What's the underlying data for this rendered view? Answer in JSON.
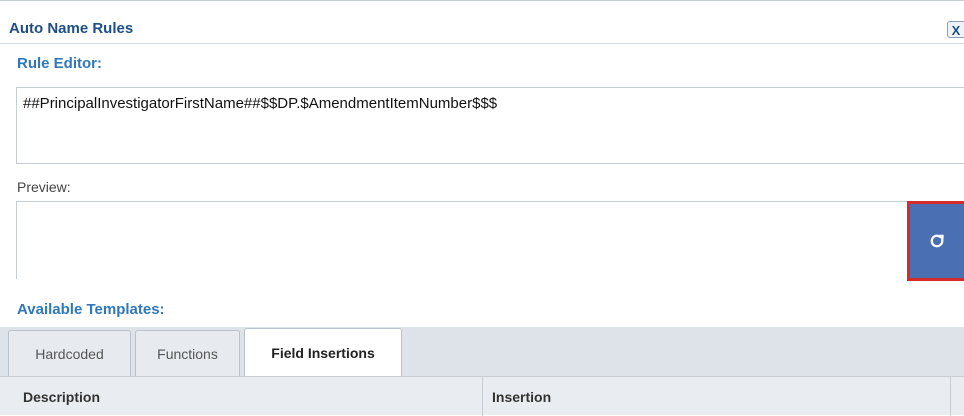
{
  "dialog": {
    "title": "Auto Name Rules",
    "close_label": "X"
  },
  "rule_editor": {
    "label": "Rule Editor:",
    "value": "##PrincipalInvestigatorFirstName##$$DP.$AmendmentItemNumber$$$"
  },
  "preview": {
    "label": "Preview:",
    "value": "",
    "refresh_icon": "refresh-icon"
  },
  "templates": {
    "label": "Available Templates:",
    "tabs": [
      {
        "label": "Hardcoded",
        "active": false
      },
      {
        "label": "Functions",
        "active": false
      },
      {
        "label": "Field Insertions",
        "active": true
      }
    ],
    "columns": [
      "Description",
      "Insertion"
    ]
  },
  "colors": {
    "title": "#1d4f86",
    "section_label": "#2f78b9",
    "refresh_button": "#4a6fb3",
    "highlight_border": "#d62b2b"
  }
}
